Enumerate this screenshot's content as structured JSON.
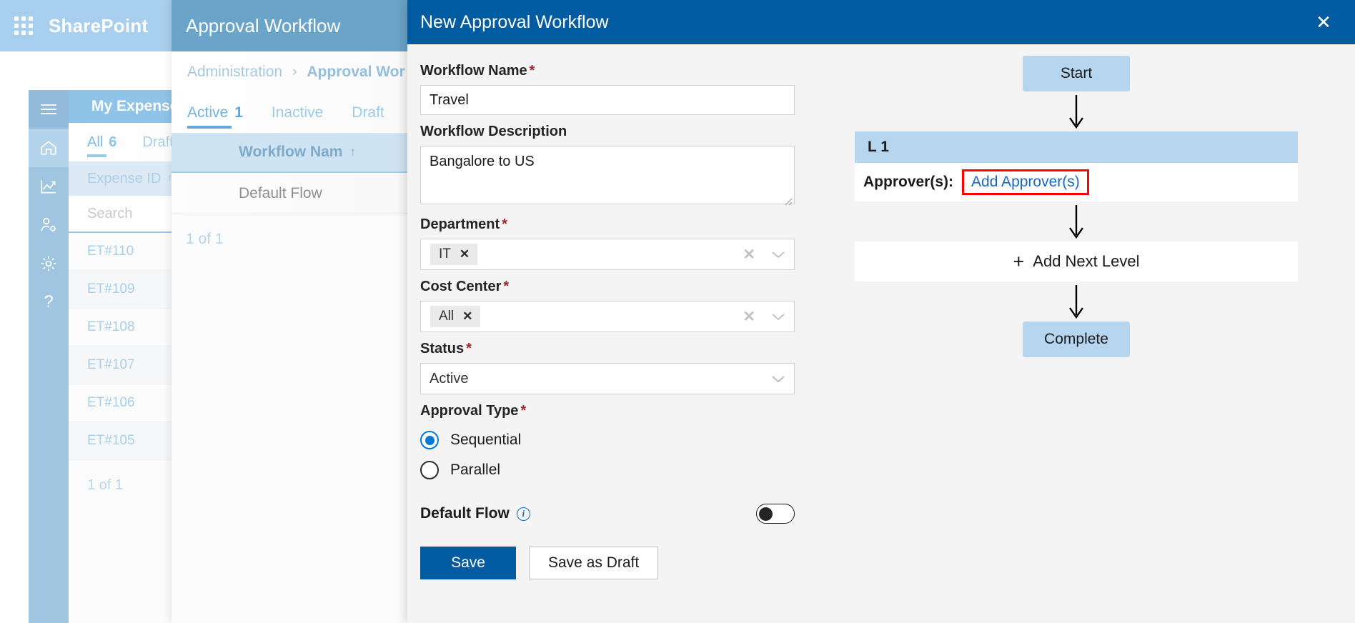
{
  "sharepoint": {
    "brand": "SharePoint",
    "waffle_icon": "grid-apps-icon"
  },
  "rail": {
    "items": [
      {
        "icon": "hamburger-icon",
        "name": "menu"
      },
      {
        "icon": "home-icon",
        "name": "home"
      },
      {
        "icon": "analytics-icon",
        "name": "reports"
      },
      {
        "icon": "user-settings-icon",
        "name": "user-admin"
      },
      {
        "icon": "gear-icon",
        "name": "settings"
      },
      {
        "icon": "help-icon",
        "name": "help",
        "glyph": "?"
      }
    ]
  },
  "expenses_panel": {
    "title": "My Expenses",
    "tabs": [
      {
        "label": "All",
        "count": "6",
        "active": true
      },
      {
        "label": "Draft",
        "count": "",
        "active": false
      }
    ],
    "column_header": "Expense ID",
    "sort_arrow": "↑",
    "search_placeholder": "Search",
    "rows": [
      "ET#110",
      "ET#109",
      "ET#108",
      "ET#107",
      "ET#106",
      "ET#105"
    ],
    "footer": "1 of 1"
  },
  "approval_panel": {
    "title": "Approval Workflow",
    "breadcrumb": {
      "root": "Administration",
      "separator": "›",
      "current": "Approval Wor"
    },
    "tabs": [
      {
        "label": "Active",
        "count": "1",
        "active": true
      },
      {
        "label": "Inactive",
        "count": "",
        "active": false
      },
      {
        "label": "Draft",
        "count": "",
        "active": false
      }
    ],
    "column_header": "Workflow Nam",
    "sort_arrow": "↑",
    "rows": [
      "Default Flow"
    ],
    "footer": "1 of 1"
  },
  "modal": {
    "title": "New Approval Workflow",
    "close_icon": "close-icon",
    "header_color": "#005ba1",
    "form": {
      "workflow_name": {
        "label": "Workflow Name",
        "required": "*",
        "value": "Travel",
        "placeholder": ""
      },
      "workflow_description": {
        "label": "Workflow Description",
        "required": "",
        "value": "Bangalore to US",
        "placeholder": ""
      },
      "department": {
        "label": "Department",
        "required": "*",
        "chips": [
          "IT"
        ],
        "chip_remove": "✕",
        "clear_icon": "✕",
        "chevron_icon": "chevron-down-icon"
      },
      "cost_center": {
        "label": "Cost Center",
        "required": "*",
        "chips": [
          "All"
        ],
        "chip_remove": "✕",
        "clear_icon": "✕",
        "chevron_icon": "chevron-down-icon"
      },
      "status": {
        "label": "Status",
        "required": "*",
        "value": "Active",
        "chevron_icon": "chevron-down-icon"
      },
      "approval_type": {
        "label": "Approval Type",
        "required": "*",
        "options": [
          {
            "label": "Sequential",
            "selected": true
          },
          {
            "label": "Parallel",
            "selected": false
          }
        ]
      },
      "default_flow": {
        "label": "Default Flow",
        "info_icon": "info-icon",
        "toggle_on": false
      },
      "buttons": {
        "save": "Save",
        "save_as_draft": "Save as Draft"
      }
    },
    "flow": {
      "start": "Start",
      "level": {
        "title": "L 1",
        "approvers_label": "Approver(s):",
        "add_approvers_link": "Add Approver(s)",
        "highlight_color": "#ff0000"
      },
      "add_next_level": "Add Next Level",
      "add_icon": "plus-icon",
      "complete": "Complete",
      "arrow_icon": "arrow-down-icon",
      "node_color": "#b5d6ee"
    }
  }
}
